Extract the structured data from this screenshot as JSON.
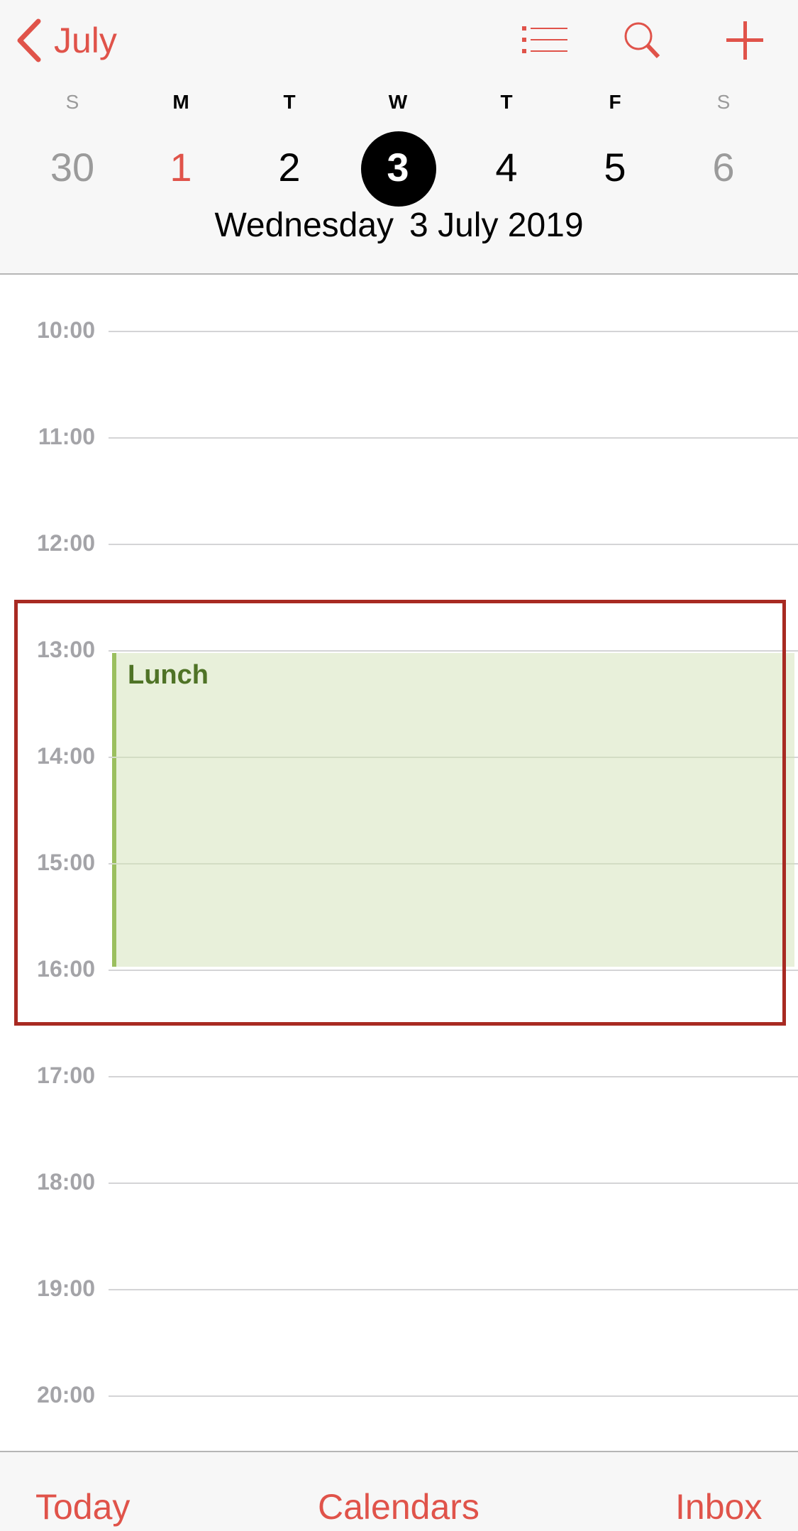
{
  "header": {
    "back_label": "July",
    "icons": {
      "back": "chevron-left-icon",
      "list": "list-icon",
      "search": "search-icon",
      "add": "plus-icon"
    },
    "weekdays": [
      {
        "label": "S",
        "weekend": true
      },
      {
        "label": "M",
        "weekend": false
      },
      {
        "label": "T",
        "weekend": false
      },
      {
        "label": "W",
        "weekend": false
      },
      {
        "label": "T",
        "weekend": false
      },
      {
        "label": "F",
        "weekend": false
      },
      {
        "label": "S",
        "weekend": true
      }
    ],
    "dates": [
      {
        "label": "30",
        "state": "weekend"
      },
      {
        "label": "1",
        "state": "today"
      },
      {
        "label": "2",
        "state": "normal"
      },
      {
        "label": "3",
        "state": "selected"
      },
      {
        "label": "4",
        "state": "normal"
      },
      {
        "label": "5",
        "state": "normal"
      },
      {
        "label": "6",
        "state": "weekend"
      }
    ],
    "selected_day_name": "Wednesday",
    "selected_date_text": "3 July 2019"
  },
  "timeline": {
    "hours": [
      "10:00",
      "11:00",
      "12:00",
      "13:00",
      "14:00",
      "15:00",
      "16:00",
      "17:00",
      "18:00",
      "19:00",
      "20:00"
    ],
    "events": [
      {
        "title": "Lunch",
        "start": "13:00",
        "end": "16:00",
        "calendar_color": "#9bbf5f"
      }
    ]
  },
  "tabbar": {
    "today": "Today",
    "calendars": "Calendars",
    "inbox": "Inbox"
  },
  "colors": {
    "accent": "#e0534a",
    "event_bg": "#e8f0da",
    "event_text": "#4f7326",
    "annotation": "#a82a22"
  }
}
